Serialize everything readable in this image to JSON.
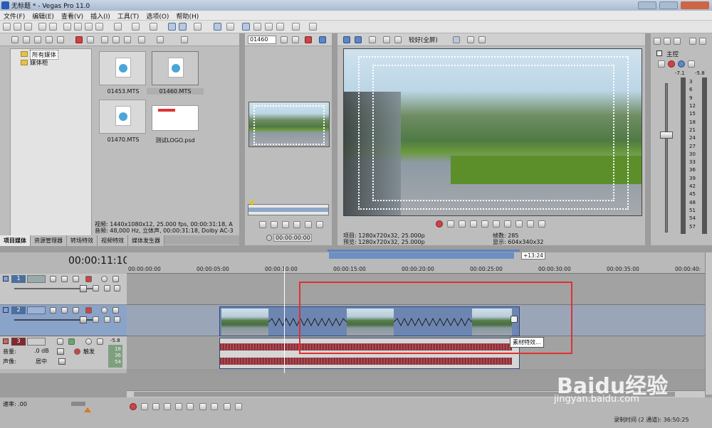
{
  "window": {
    "title": "无标题 * - Vegas Pro 11.0"
  },
  "menu": [
    "文件(F)",
    "编辑(E)",
    "查看(V)",
    "插入(I)",
    "工具(T)",
    "选项(O)",
    "帮助(H)"
  ],
  "explorer": {
    "tree": [
      {
        "label": "所有媒体",
        "selected": true
      },
      {
        "label": "媒体柜",
        "selected": false
      }
    ],
    "files": [
      {
        "name": "01453.MTS",
        "kind": "video"
      },
      {
        "name": "01460.MTS",
        "kind": "video",
        "selected": true
      },
      {
        "name": "01470.MTS",
        "kind": "video"
      },
      {
        "name": "测试LOGO.psd",
        "kind": "image"
      }
    ],
    "info": [
      "视频: 1440x1080x12, 25.000 fps, 00:00:31:18, A",
      "音频: 48,000 Hz, 立体声, 00:00:31:18, Dolby AC-3"
    ],
    "tabs": [
      "项目媒体",
      "资源管理器",
      "转场特效",
      "视频特效",
      "媒体发生器"
    ]
  },
  "trimmer": {
    "selected_clip": "01460",
    "timecode": "00:00:00:00"
  },
  "preview": {
    "quality": "较好(全屏)",
    "info_left": [
      "项目: 1280x720x32, 25.000p",
      "预览: 1280x720x32, 25.000p"
    ],
    "info_right": [
      "帧数: 285",
      "显示: 604x340x32"
    ]
  },
  "mixer": {
    "label": "主控",
    "peak_left": "-7.1",
    "peak_right": "-5.8",
    "scale": [
      "3",
      "6",
      "9",
      "12",
      "15",
      "18",
      "21",
      "24",
      "27",
      "30",
      "33",
      "36",
      "39",
      "42",
      "45",
      "48",
      "51",
      "54",
      "57"
    ]
  },
  "timeline": {
    "current_time": "00:00:11:10",
    "marker_label": "+13:24",
    "ruler_labels": [
      "00:00:00:00",
      "00:00:05:00",
      "00:00:10:00",
      "00:00:15:00",
      "00:00:20:00",
      "00:00:25:00",
      "00:00:30:00",
      "00:00:35:00",
      "00:00:40:"
    ],
    "tracks": [
      {
        "number": "1",
        "type": "video"
      },
      {
        "number": "2",
        "type": "video"
      },
      {
        "number": "3",
        "type": "audio",
        "volume_label": "音量:",
        "volume_value": ".0 dB",
        "touch": "触发",
        "pan_label": "声像:",
        "pan_value": "居中",
        "meter_peak": "-5.8",
        "meter_vals": [
          "18",
          "36",
          "54"
        ]
      }
    ],
    "tooltip": "素材特效..."
  },
  "bottom": {
    "rate_label": "速率: .00",
    "status": "录制时间 (2 通道): 36:50:25"
  },
  "watermark": {
    "text": "Baidu经验",
    "url": "jingyan.baidu.com"
  },
  "colors": {
    "highlight": "#e0302f",
    "track_selected": "#8aa3c9",
    "audio_wave": "#8e2f3c",
    "title_bar": "#b8c8dc"
  }
}
